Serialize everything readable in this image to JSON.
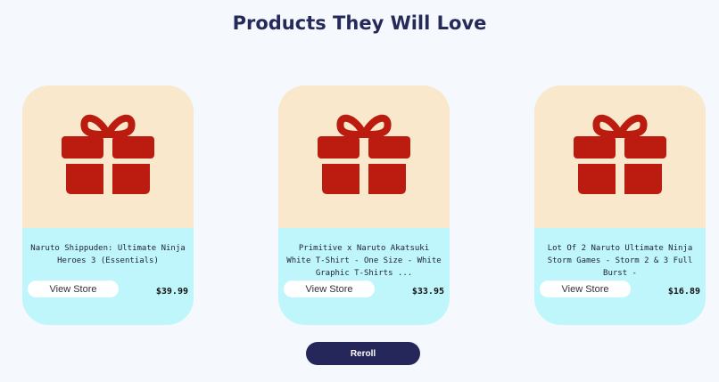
{
  "header": {
    "title": "Products They Will Love"
  },
  "products": [
    {
      "title": "Naruto Shippuden: Ultimate Ninja Heroes 3 (Essentials)",
      "button_label": "View Store",
      "price": "$39.99",
      "icon": "gift-icon"
    },
    {
      "title": "Primitive x Naruto Akatsuki White T-Shirt - One Size - White Graphic T-Shirts ...",
      "button_label": "View Store",
      "price": "$33.95",
      "icon": "gift-icon"
    },
    {
      "title": "Lot Of 2 Naruto Ultimate Ninja Storm Games - Storm 2 & 3 Full Burst -",
      "button_label": "View Store",
      "price": "$16.89",
      "icon": "gift-icon"
    }
  ],
  "actions": {
    "reroll_label": "Reroll"
  },
  "colors": {
    "title": "#252a5a",
    "card_top": "#f9e8cc",
    "card_bottom": "#bff6fb",
    "gift": "#bc1b0f",
    "reroll_bg": "#25275a",
    "page_bg": "#f5f9fd"
  }
}
